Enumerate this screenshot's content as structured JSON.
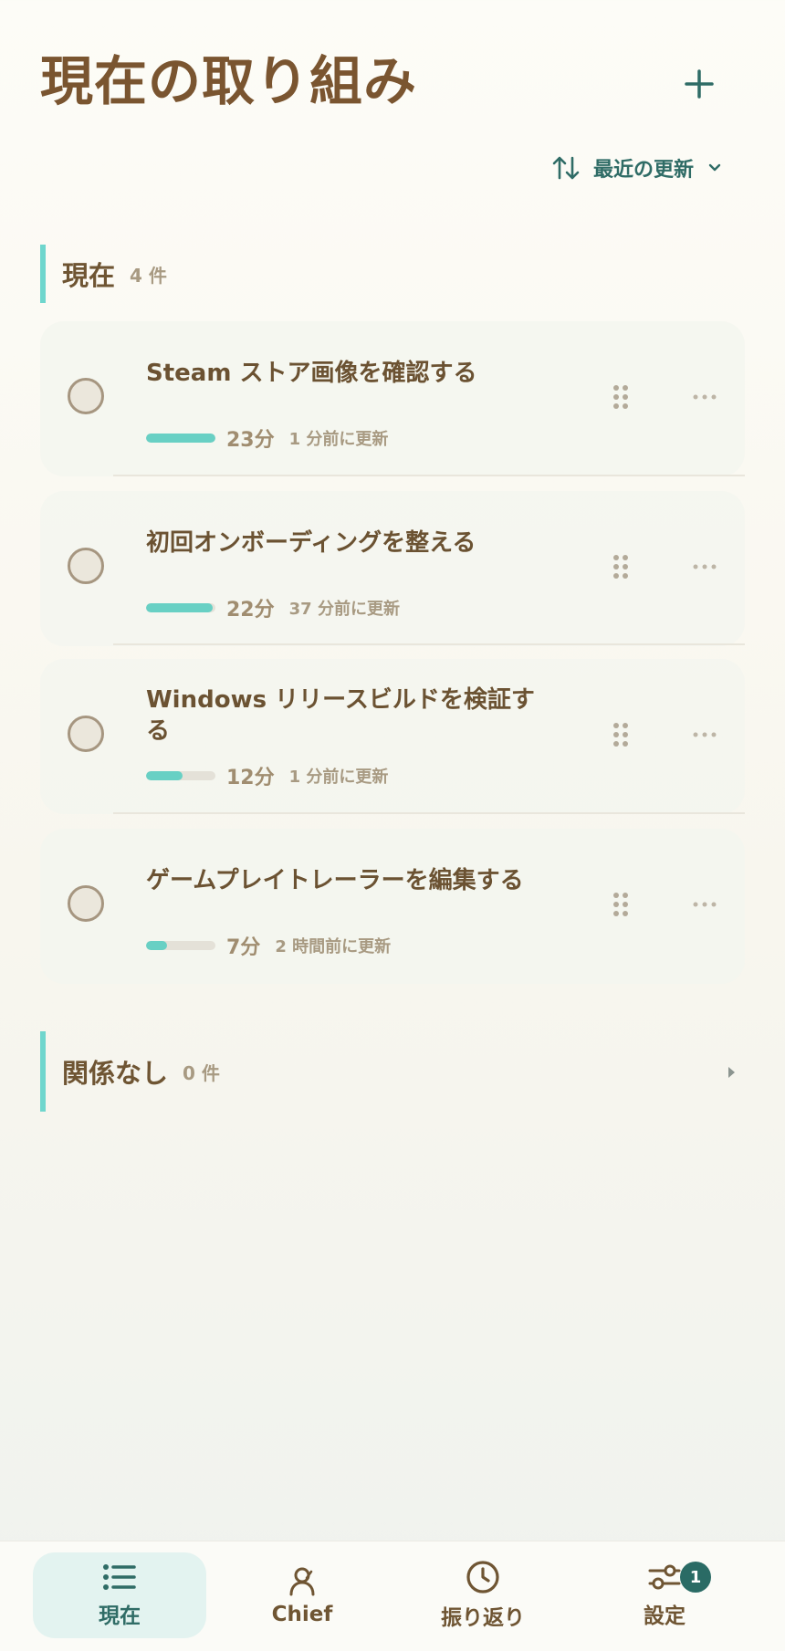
{
  "header": {
    "title": "現在の取り組み",
    "add_icon": "plus-icon"
  },
  "sort": {
    "label": "最近の更新",
    "icon": "sort-arrows-icon"
  },
  "colors": {
    "accent": "#2f6c66",
    "progress": "#68d0c4",
    "section_bar": "#6fd6cd",
    "title_brown": "#7a5530"
  },
  "sections": {
    "current": {
      "title": "現在",
      "count": "4 件",
      "items": [
        {
          "title": "Steam ストア画像を確認する",
          "duration": "23分",
          "updated": "1 分前に更新",
          "progress": 1.0
        },
        {
          "title": "初回オンボーディングを整える",
          "duration": "22分",
          "updated": "37 分前に更新",
          "progress": 0.96
        },
        {
          "title": "Windows リリースビルドを検証する",
          "duration": "12分",
          "updated": "1 分前に更新",
          "progress": 0.52
        },
        {
          "title": "ゲームプレイトレーラーを編集する",
          "duration": "7分",
          "updated": "2 時間前に更新",
          "progress": 0.3
        }
      ]
    },
    "unrelated": {
      "title": "関係なし",
      "count": "0 件",
      "collapsed": true
    }
  },
  "tabs": [
    {
      "label": "現在",
      "icon": "list-icon",
      "active": true
    },
    {
      "label": "Chief",
      "icon": "person-icon",
      "active": false
    },
    {
      "label": "振り返り",
      "icon": "clock-icon",
      "active": false
    },
    {
      "label": "設定",
      "icon": "sliders-icon",
      "active": false,
      "badge": "1"
    }
  ]
}
